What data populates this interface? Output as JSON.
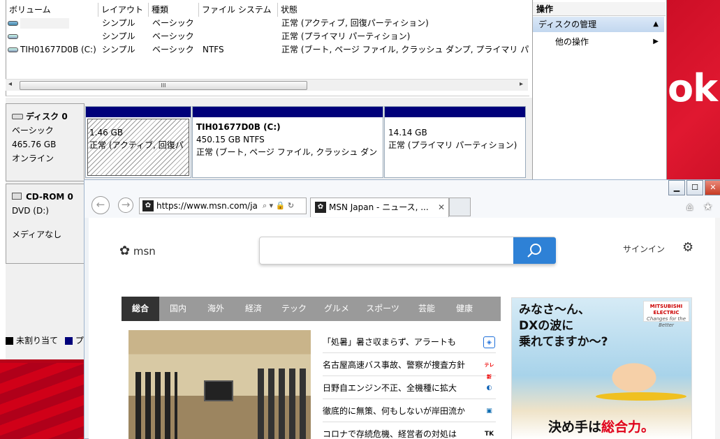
{
  "disk_management": {
    "columns": [
      "ボリューム",
      "レイアウト",
      "種類",
      "ファイル システム",
      "状態"
    ],
    "rows": [
      {
        "volume": "",
        "layout": "シンプル",
        "type": "ベーシック",
        "fs": "",
        "status": "正常 (アクティブ, 回復パーティション)"
      },
      {
        "volume": "",
        "layout": "シンプル",
        "type": "ベーシック",
        "fs": "",
        "status": "正常 (プライマリ パーティション)"
      },
      {
        "volume": "TIH01677D0B (C:)",
        "layout": "シンプル",
        "type": "ベーシック",
        "fs": "NTFS",
        "status": "正常 (ブート, ページ ファイル, クラッシュ ダンプ, プライマリ パ"
      }
    ],
    "scroll_thumb_label": "III",
    "disk0": {
      "name": "ディスク 0",
      "kind": "ベーシック",
      "size": "465.76 GB",
      "state": "オンライン"
    },
    "partitions": [
      {
        "name": "",
        "size": "1.46 GB",
        "status": "正常 (アクティブ, 回復パ"
      },
      {
        "name": "TIH01677D0B (C:)",
        "size": "450.15 GB NTFS",
        "status": "正常 (ブート, ページ ファイル, クラッシュ ダン"
      },
      {
        "name": "",
        "size": "14.14 GB",
        "status": "正常 (プライマリ パーティション)"
      }
    ],
    "cdrom": {
      "name": "CD-ROM 0",
      "drive": "DVD (D:)",
      "media": "メディアなし"
    },
    "legend": {
      "unallocated": "未割り当て",
      "primary": "プ"
    }
  },
  "operations": {
    "title": "操作",
    "manage": "ディスクの管理",
    "other": "他の操作"
  },
  "browser": {
    "address": "https://www.msn.com/ja",
    "tab_title": "MSN Japan - ニュース, ...",
    "msn_label": "msn",
    "signin": "サインイン",
    "categories": [
      "総合",
      "国内",
      "海外",
      "経済",
      "テック",
      "グルメ",
      "スポーツ",
      "芸能",
      "健康"
    ],
    "news": [
      {
        "title": "「処暑」暑さ収まらず、アラートも",
        "source": "◈"
      },
      {
        "title": "名古屋高速バス事故、警察が捜査方針",
        "source": "テレ新"
      },
      {
        "title": "日野自エンジン不正、全機種に拡大",
        "source": "◐"
      },
      {
        "title": "徹底的に無策、何もしないが岸田流か",
        "source": "▣"
      },
      {
        "title": "コロナで存続危機、経営者の対処は",
        "source": "TK"
      }
    ],
    "ad": {
      "text": [
        "みなさ〜ん、",
        "DXの波に",
        "乗れてますか〜?"
      ],
      "brand": "MITSUBISHI ELECTRIC",
      "brand_sub": "Changes for the Better",
      "bottom": "決め手は",
      "bottom_highlight": "総合力。"
    }
  },
  "desktop": {
    "big_text": "ok"
  },
  "colors": {
    "primary_partition": "#00007a",
    "search_blue": "#2e81d6",
    "accent_red": "#c8102e"
  }
}
